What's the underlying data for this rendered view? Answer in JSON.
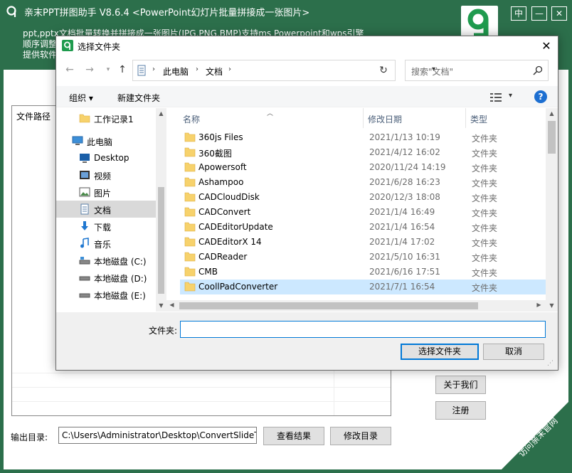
{
  "app": {
    "title": "亲末PPT拼图助手   V8.6.4   <PowerPoint幻灯片批量拼接成一张图片>",
    "pin_label": "中",
    "min_label": "—",
    "close_label": "✕",
    "desc_lines": [
      "ppt,pptx文档批量转换并拼接成一张图片(JPG,PNG,BMP)支持ms Powerpoint和wps引擎",
      "顺序调整",
      "提供软件"
    ],
    "filelist_header": "文件路径",
    "about_label": "关于我们",
    "register_label": "注册",
    "output_label": "输出目录:",
    "output_path": "C:\\Users\\Administrator\\Desktop\\ConvertSlideToOr",
    "view_result_label": "查看结果",
    "change_dir_label": "修改目录",
    "corner_link": "访问亲末官网"
  },
  "dialog": {
    "title": "选择文件夹",
    "close_label": "✕",
    "address": [
      "此电脑",
      "文档"
    ],
    "search_placeholder": "搜索\"文档\"",
    "toolbar": {
      "organize_label": "组织 ▾",
      "newfolder_label": "新建文件夹",
      "help_label": "?"
    },
    "nav": [
      {
        "label": "工作记录1",
        "icon": "folder-icon",
        "indent": 1
      },
      {
        "label": "此电脑",
        "icon": "pc-icon",
        "indent": 0
      },
      {
        "label": "Desktop",
        "icon": "desktop-icon",
        "indent": 1
      },
      {
        "label": "视频",
        "icon": "video-icon",
        "indent": 1
      },
      {
        "label": "图片",
        "icon": "picture-icon",
        "indent": 1
      },
      {
        "label": "文档",
        "icon": "document-icon",
        "indent": 1,
        "selected": true
      },
      {
        "label": "下载",
        "icon": "download-icon",
        "indent": 1
      },
      {
        "label": "音乐",
        "icon": "music-icon",
        "indent": 1
      },
      {
        "label": "本地磁盘 (C:)",
        "icon": "drive-c-icon",
        "indent": 1
      },
      {
        "label": "本地磁盘 (D:)",
        "icon": "drive-icon",
        "indent": 1
      },
      {
        "label": "本地磁盘 (E:)",
        "icon": "drive-icon",
        "indent": 1
      }
    ],
    "columns": {
      "name": "名称",
      "date": "修改日期",
      "type": "类型"
    },
    "files": [
      {
        "name": "360js Files",
        "date": "2021/1/13 10:19",
        "type": "文件夹"
      },
      {
        "name": "360截图",
        "date": "2021/4/12 16:02",
        "type": "文件夹"
      },
      {
        "name": "Apowersoft",
        "date": "2020/11/24 14:19",
        "type": "文件夹"
      },
      {
        "name": "Ashampoo",
        "date": "2021/6/28 16:23",
        "type": "文件夹"
      },
      {
        "name": "CADCloudDisk",
        "date": "2020/12/3 18:08",
        "type": "文件夹"
      },
      {
        "name": "CADConvert",
        "date": "2021/1/4 16:49",
        "type": "文件夹"
      },
      {
        "name": "CADEditorUpdate",
        "date": "2021/1/4 16:54",
        "type": "文件夹"
      },
      {
        "name": "CADEditorX 14",
        "date": "2021/1/4 17:02",
        "type": "文件夹"
      },
      {
        "name": "CADReader",
        "date": "2021/5/10 16:31",
        "type": "文件夹"
      },
      {
        "name": "CMB",
        "date": "2021/6/16 17:51",
        "type": "文件夹"
      },
      {
        "name": "CoollPadConverter",
        "date": "2021/7/1 16:54",
        "type": "文件夹",
        "selected": true
      }
    ],
    "folder_label": "文件夹:",
    "folder_value": "",
    "select_label": "选择文件夹",
    "cancel_label": "取消"
  },
  "colors": {
    "app_green": "#2c6f4b",
    "accent_blue": "#0078d7",
    "selection_blue": "#cce8ff",
    "folder_yellow": "#f7d26c"
  }
}
